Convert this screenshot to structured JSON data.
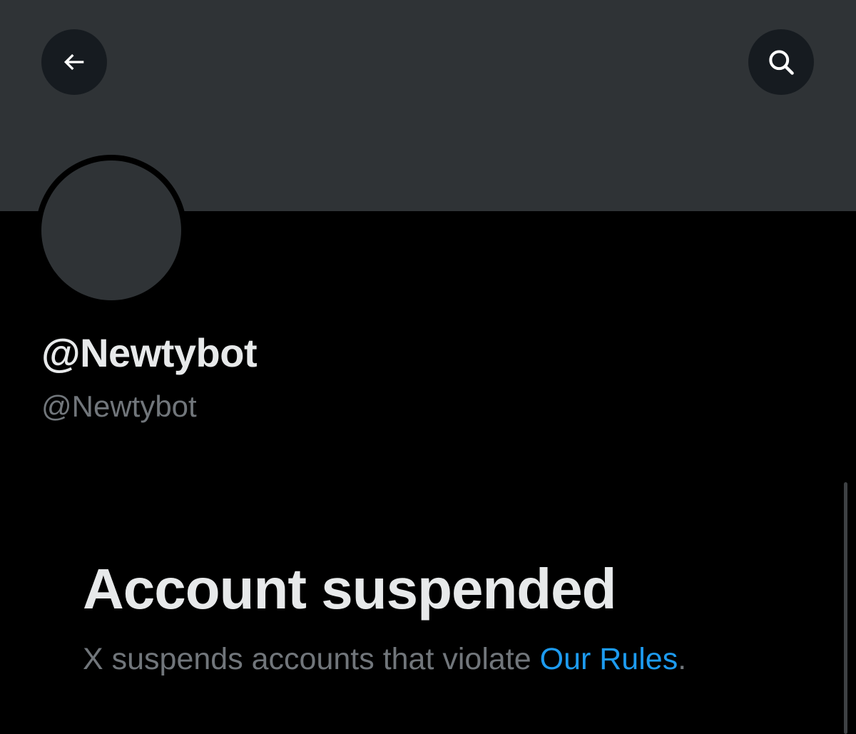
{
  "header": {
    "back_icon": "arrow-left-icon",
    "search_icon": "search-icon"
  },
  "profile": {
    "display_name": "@Newtybot",
    "handle": "@Newtybot"
  },
  "suspension": {
    "title": "Account suspended",
    "message_prefix": "X suspends accounts that violate ",
    "rules_link": "Our Rules",
    "message_suffix": "."
  },
  "colors": {
    "background": "#000000",
    "banner": "#2f3336",
    "primary_text": "#e7e9ea",
    "secondary_text": "#71767b",
    "link": "#1d9bf0"
  }
}
